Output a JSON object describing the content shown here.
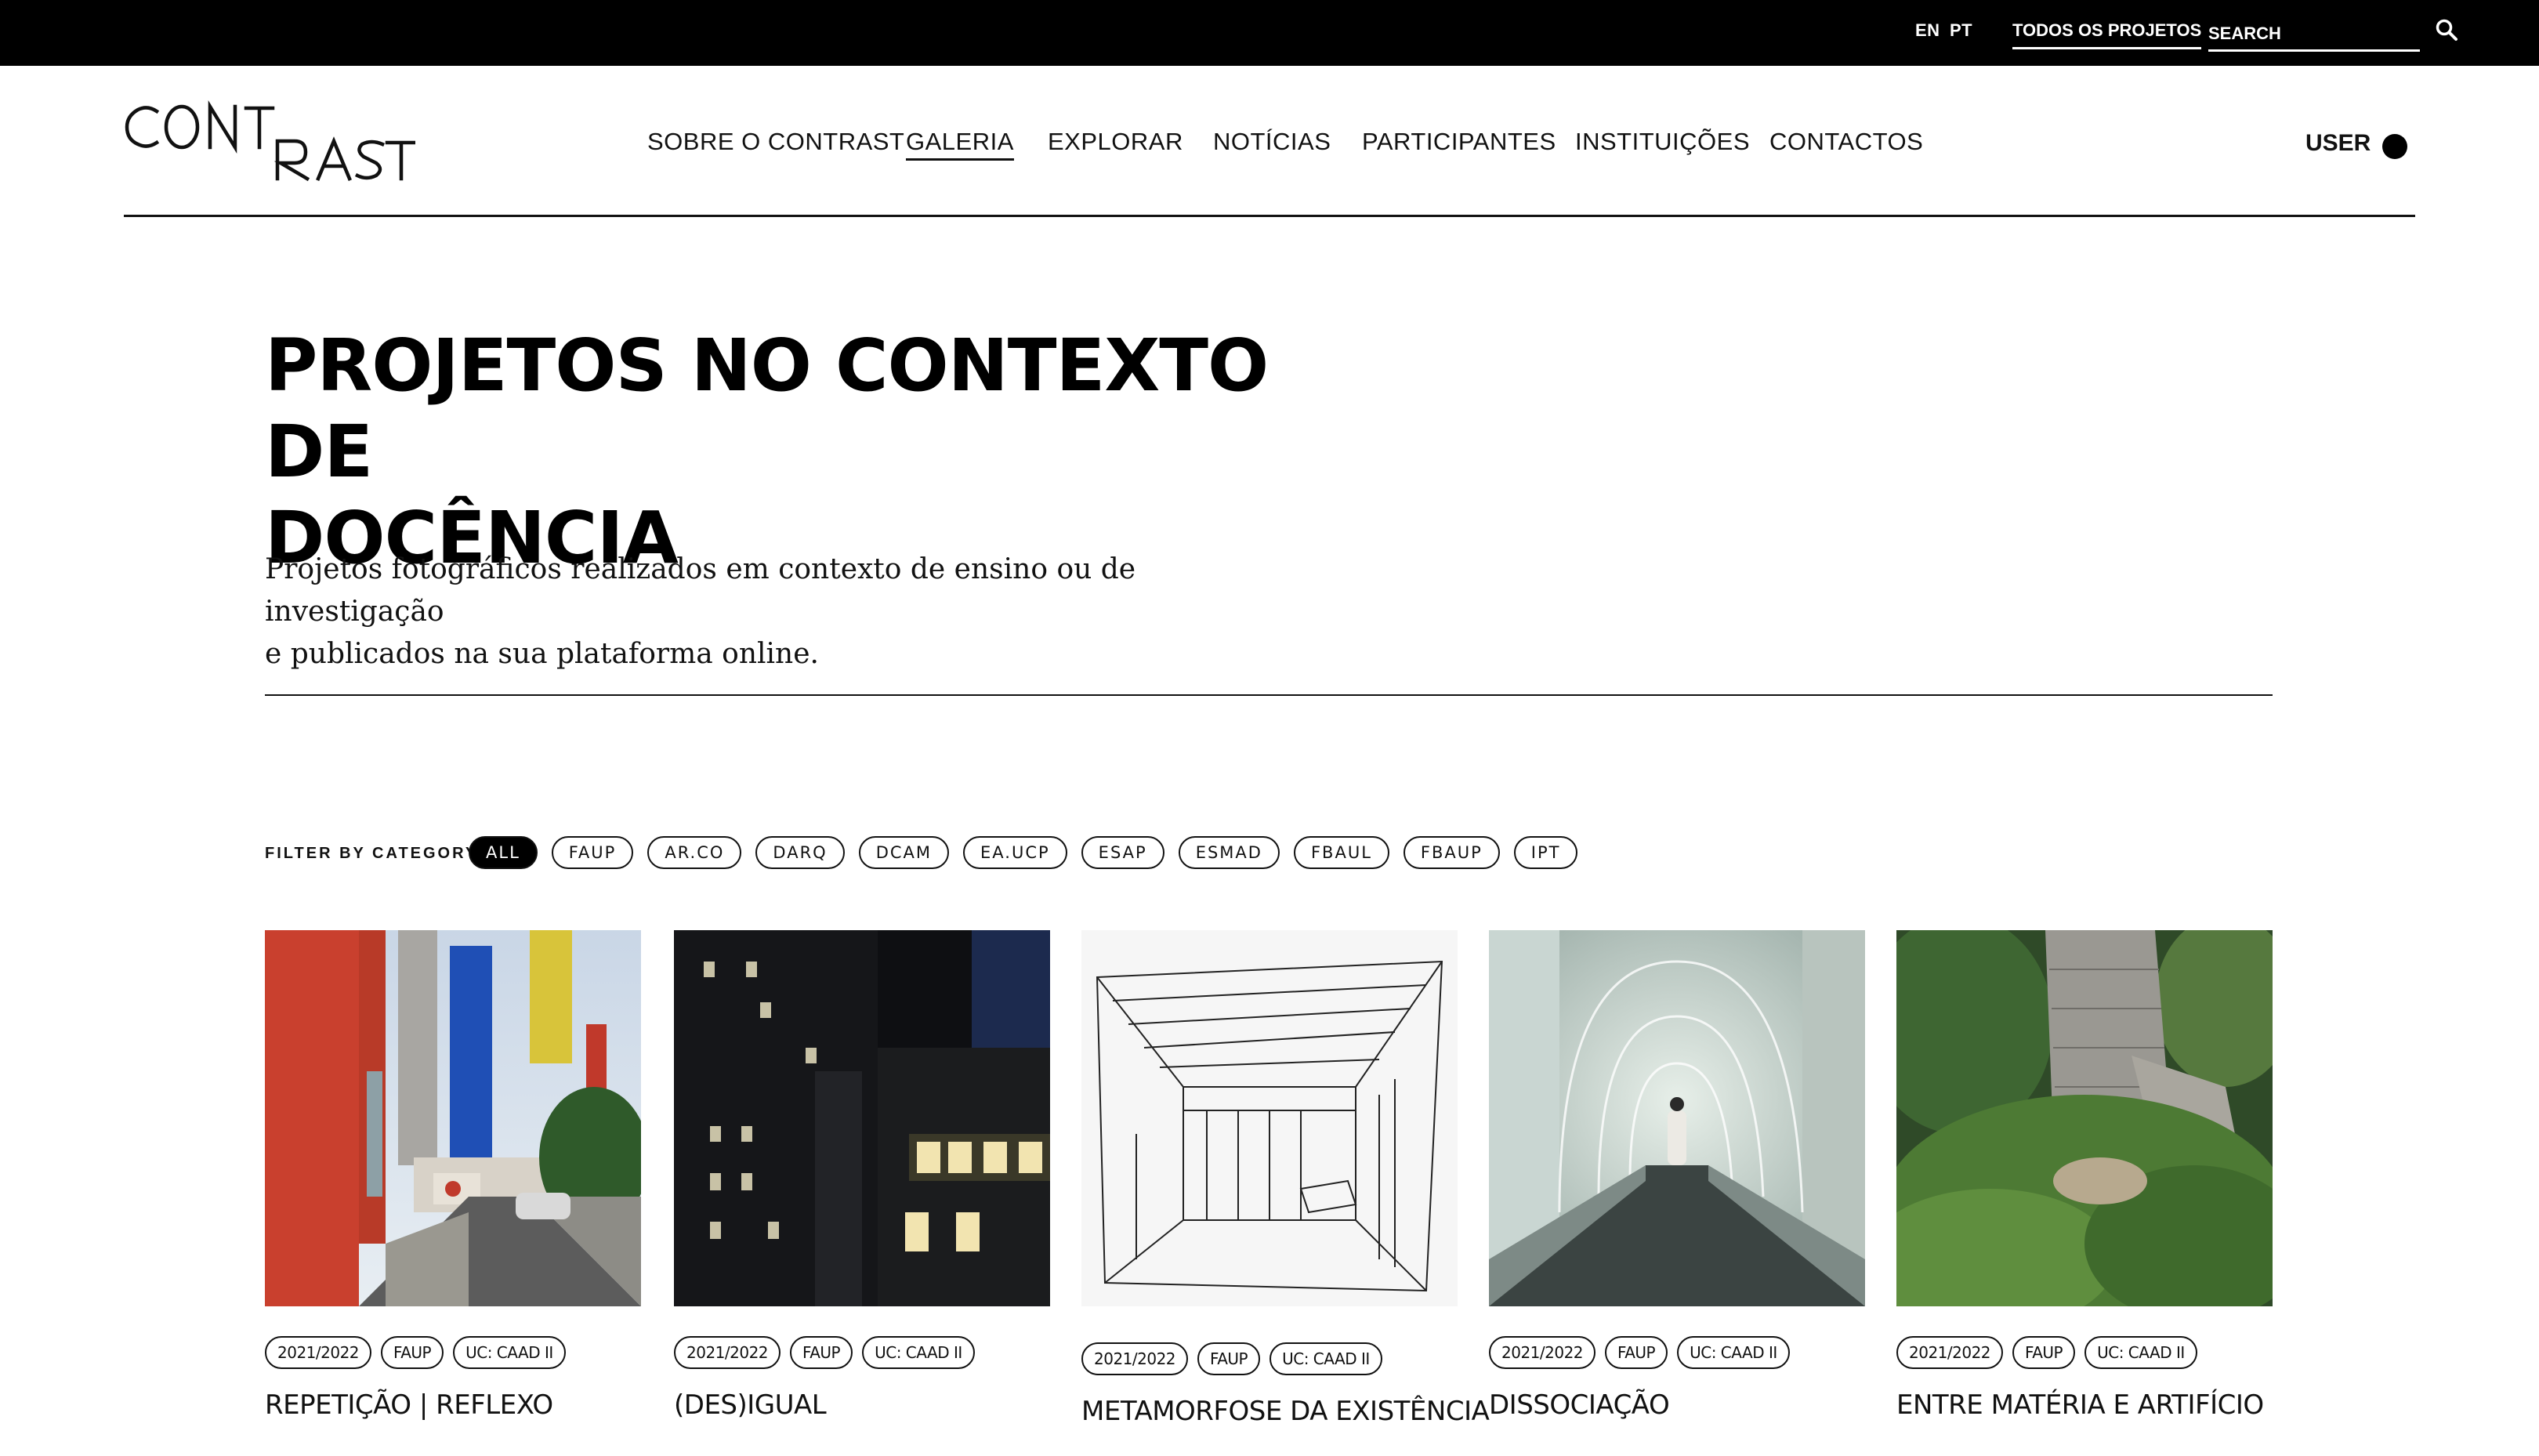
{
  "topbar": {
    "languages": [
      "EN",
      "PT"
    ],
    "all_projects": "TODOS OS PROJETOS",
    "search_placeholder": "SEARCH"
  },
  "header": {
    "logo_text": "CONTRAST",
    "nav": [
      {
        "label": "SOBRE O CONTRAST",
        "active": false
      },
      {
        "label": "GALERIA",
        "active": true
      },
      {
        "label": "EXPLORAR",
        "active": false
      },
      {
        "label": "NOTÍCIAS",
        "active": false
      },
      {
        "label": "PARTICIPANTES",
        "active": false
      },
      {
        "label": "INSTITUIÇÕES",
        "active": false
      },
      {
        "label": "CONTACTOS",
        "active": false
      }
    ],
    "user_label": "USER"
  },
  "hero": {
    "title_line1": "PROJETOS NO CONTEXTO DE",
    "title_line2": "DOCÊNCIA",
    "description_line1": "Projetos fotográficos realizados em contexto de ensino ou de investigação",
    "description_line2": "e publicados na sua plataforma online."
  },
  "filter": {
    "label": "FILTER BY CATEGORY:",
    "options": [
      "ALL",
      "FAUP",
      "AR.CO",
      "DARQ",
      "DCAM",
      "EA.UCP",
      "ESAP",
      "ESMAD",
      "FBAUL",
      "FBAUP",
      "IPT"
    ],
    "selected": "ALL"
  },
  "projects": [
    {
      "tags": [
        "2021/2022",
        "FAUP",
        "UC: CAAD II"
      ],
      "title": "REPETIÇÃO | REFLEXO",
      "image": "colored towers street photo"
    },
    {
      "tags": [
        "2021/2022",
        "FAUP",
        "UC: CAAD II"
      ],
      "title": "(DES)IGUAL",
      "image": "building facade at night"
    },
    {
      "tags": [
        "2021/2022",
        "FAUP",
        "UC: CAAD II"
      ],
      "title": "METAMORFOSE DA EXISTÊNCIA",
      "image": "pencil sketch of interior"
    },
    {
      "tags": [
        "2021/2022",
        "FAUP",
        "UC: CAAD II"
      ],
      "title": "DISSOCIAÇÃO",
      "image": "glass tunnel corridor"
    },
    {
      "tags": [
        "2021/2022",
        "FAUP",
        "UC: CAAD II"
      ],
      "title": "ENTRE MATÉRIA E ARTIFÍCIO",
      "image": "ruined concrete wall with vegetation"
    }
  ]
}
